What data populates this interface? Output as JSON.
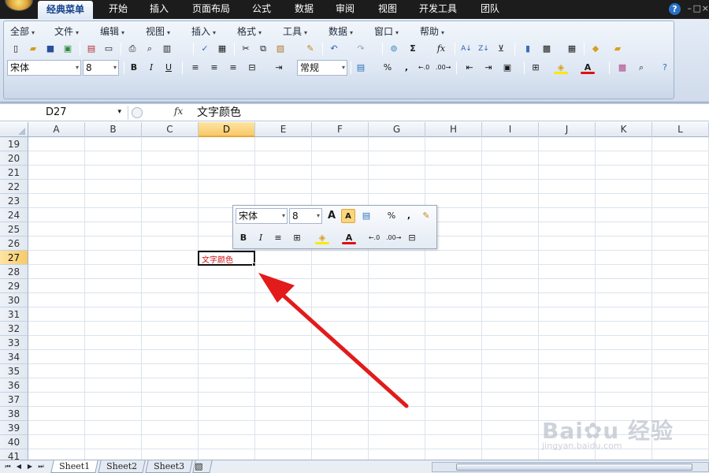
{
  "ribbon": {
    "tabs": [
      {
        "label": "经典菜单",
        "active": true
      },
      {
        "label": "开始"
      },
      {
        "label": "插入"
      },
      {
        "label": "页面布局"
      },
      {
        "label": "公式"
      },
      {
        "label": "数据"
      },
      {
        "label": "审阅"
      },
      {
        "label": "视图"
      },
      {
        "label": "开发工具"
      },
      {
        "label": "团队"
      }
    ],
    "help_label": "?",
    "window_controls": [
      "–",
      "□",
      "×"
    ]
  },
  "classic_menu": {
    "items": [
      "全部",
      "文件",
      "编辑",
      "视图",
      "插入",
      "格式",
      "工具",
      "数据",
      "窗口",
      "帮助"
    ]
  },
  "toolbar": {
    "font_name": "宋体",
    "font_size": "8",
    "number_format": "常规",
    "bold": "B",
    "italic": "I",
    "underline": "U",
    "percent": "%",
    "comma": ",",
    "sum": "Σ",
    "fx": "fx",
    "font_color_letter": "A"
  },
  "formula_bar": {
    "name_box": "D27",
    "fx_label": "fx",
    "content": "文字颜色"
  },
  "grid": {
    "columns": [
      "A",
      "B",
      "C",
      "D",
      "E",
      "F",
      "G",
      "H",
      "I",
      "J",
      "K",
      "L"
    ],
    "selected_column": "D",
    "rows": [
      "19",
      "20",
      "21",
      "22",
      "23",
      "24",
      "25",
      "26",
      "27",
      "28",
      "29",
      "30",
      "31",
      "32",
      "33",
      "34",
      "35",
      "36",
      "37",
      "38",
      "39",
      "40",
      "41"
    ],
    "selected_row": "27",
    "active_cell": {
      "ref": "D27",
      "value": "文字颜色",
      "text_color": "#d01010"
    }
  },
  "mini_toolbar": {
    "font_name": "宋体",
    "font_size": "8",
    "grow_font": "A",
    "shrink_font": "A",
    "percent": "%",
    "comma": ",",
    "bold": "B",
    "italic": "I",
    "font_color_letter": "A"
  },
  "sheets": {
    "tabs": [
      "Sheet1",
      "Sheet2",
      "Sheet3"
    ],
    "active": "Sheet1"
  },
  "watermark": {
    "url": "jingyan.baidu.com"
  },
  "colors": {
    "annotation_arrow": "#e21b1b",
    "font_color_bar": "#e01010",
    "highlight_bar": "#ffe800",
    "selection_header": "#f8c968"
  }
}
